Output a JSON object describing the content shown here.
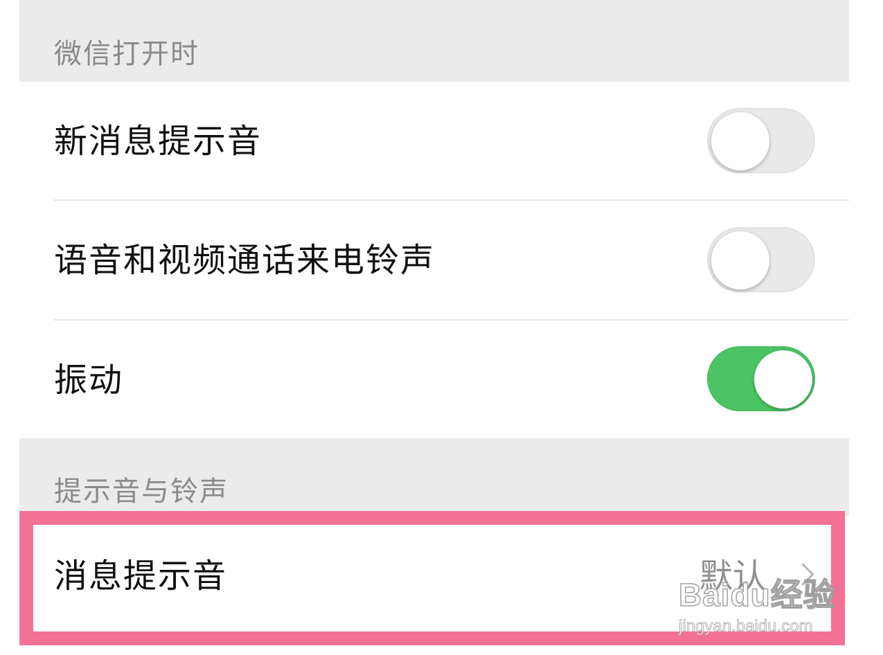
{
  "sections": {
    "when_open": {
      "header": "微信打开时"
    },
    "sounds": {
      "header": "提示音与铃声"
    }
  },
  "settings": {
    "new_message_sound": {
      "label": "新消息提示音",
      "enabled": false
    },
    "call_ringtone": {
      "label": "语音和视频通话来电铃声",
      "enabled": false
    },
    "vibrate": {
      "label": "振动",
      "enabled": true
    }
  },
  "message_tone": {
    "label": "消息提示音",
    "value": "默认",
    "icon": "chevron-right-icon"
  },
  "watermark": {
    "brand": "Baidu经验",
    "url": "jingyan.baidu.com"
  },
  "colors": {
    "toggle_on": "#4cc465",
    "toggle_off": "#e9e9e9",
    "highlight_border": "#f47196",
    "group_background": "#ebebeb"
  }
}
